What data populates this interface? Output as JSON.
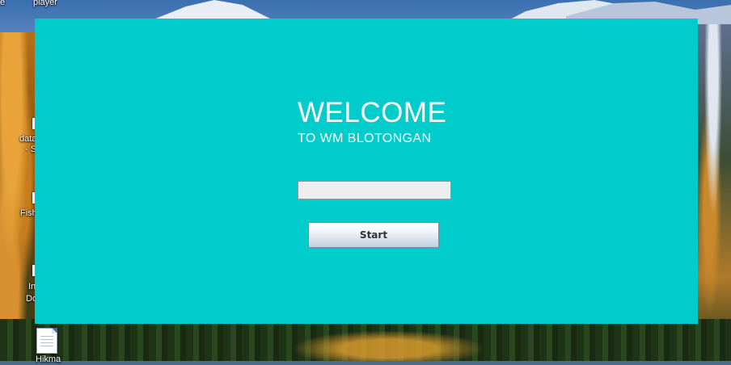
{
  "desktop": {
    "icons": [
      {
        "label": "player"
      },
      {
        "label": "e"
      },
      {
        "label": "data"
      },
      {
        "label": "- S"
      },
      {
        "label": "Fish"
      },
      {
        "label": "In"
      },
      {
        "label": "Do"
      },
      {
        "label": "Hikma"
      }
    ]
  },
  "app": {
    "background_color": "#00cccc",
    "title": "WELCOME",
    "subtitle": "TO WM BLOTONGAN",
    "input": {
      "value": "",
      "placeholder": ""
    },
    "start_label": "Start"
  }
}
